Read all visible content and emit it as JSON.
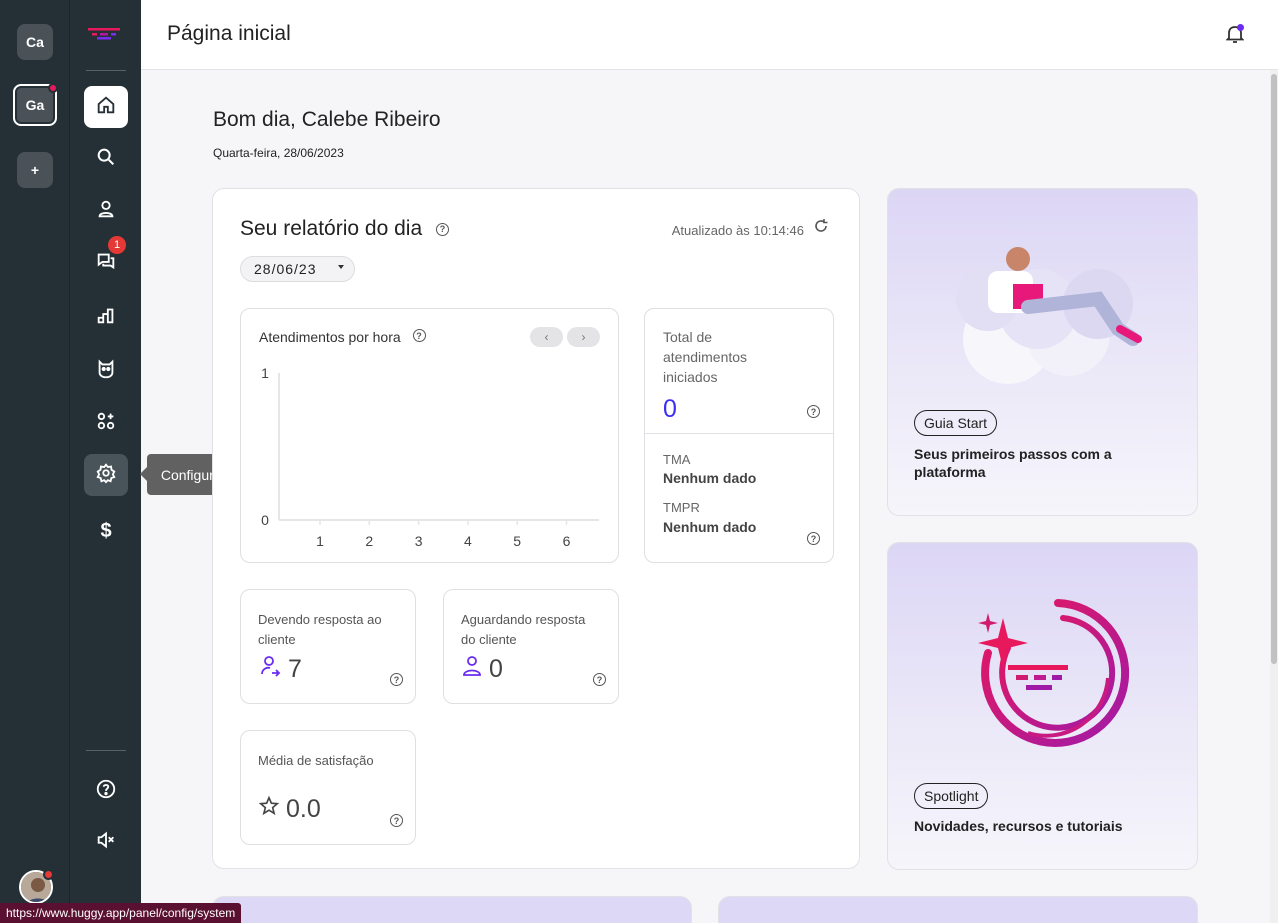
{
  "workspaces": [
    {
      "label": "Ca",
      "active": false
    },
    {
      "label": "Ga",
      "active": true,
      "notification": true
    },
    {
      "label": "+"
    }
  ],
  "nav": {
    "items": [
      "home-icon",
      "search-icon",
      "contacts-icon",
      "chats-icon",
      "reports-icon",
      "bot-icon",
      "apps-icon",
      "settings-icon",
      "billing-icon"
    ],
    "chats_badge": "1",
    "bottom_items": [
      "help-icon",
      "sound-muted-icon"
    ],
    "tooltip": "Configurações"
  },
  "header": {
    "title": "Página inicial"
  },
  "greeting": {
    "text": "Bom dia, Calebe Ribeiro",
    "date": "Quarta-feira, 28/06/2023"
  },
  "report": {
    "title": "Seu relatório do dia",
    "updated": "Atualizado às 10:14:46",
    "date_chip": "28/06/23",
    "chart": {
      "title": "Atendimentos por hora",
      "prev": "‹",
      "next": "›"
    },
    "total": {
      "label": "Total de atendimentos iniciados",
      "value": "0"
    },
    "tma": {
      "label": "TMA",
      "value": "Nenhum dado"
    },
    "tmpr": {
      "label": "TMPR",
      "value": "Nenhum dado"
    },
    "awaiting_reply": {
      "label": "Devendo resposta ao cliente",
      "value": "7"
    },
    "awaiting_client": {
      "label": "Aguardando resposta do cliente",
      "value": "0"
    },
    "satisfaction": {
      "label": "Média de satisfação",
      "value": "0.0"
    }
  },
  "chart_data": {
    "type": "line",
    "title": "Atendimentos por hora",
    "x": [
      1,
      2,
      3,
      4,
      5,
      6
    ],
    "series": [
      {
        "values": []
      }
    ],
    "ylim": [
      0,
      1
    ],
    "yticks": [
      "1",
      "0"
    ],
    "xticks": [
      "1",
      "2",
      "3",
      "4",
      "5",
      "6"
    ]
  },
  "promos": [
    {
      "chip": "Guia Start",
      "text": "Seus primeiros passos com a plataforma"
    },
    {
      "chip": "Spotlight",
      "text": "Novidades, recursos e tutoriais"
    }
  ],
  "status_url": "https://www.huggy.app/panel/config/system",
  "colors": {
    "sidebar": "#253036",
    "accent": "#3b2ff0",
    "brand_pink": "#e8185c",
    "brand_purple": "#6a2cf0"
  }
}
